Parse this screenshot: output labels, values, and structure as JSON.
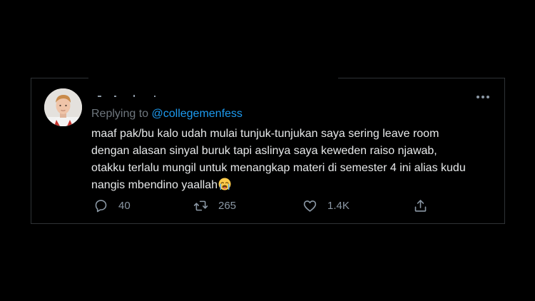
{
  "tweet": {
    "replying_prefix": "Replying to ",
    "replying_handle": "@collegemenfess",
    "text_lines": [
      "maaf pak/bu kalo udah mulai tunjuk-tunjukan saya sering leave room",
      "dengan alasan sinyal buruk tapi aslinya saya keweden raiso njawab,",
      "otakku terlalu mungil untuk menangkap materi di semester 4 ini alias kudu",
      "nangis mbendino yaallah"
    ],
    "emoji": "loudly-crying-face"
  },
  "actions": {
    "reply_count": "40",
    "retweet_count": "265",
    "like_count": "1.4K"
  },
  "icons": {
    "reply": "reply-icon",
    "retweet": "retweet-icon",
    "like": "heart-icon",
    "share": "share-icon",
    "more": "more-icon"
  },
  "colors": {
    "background": "#000000",
    "text": "#e7e9ea",
    "secondary": "#8b98a5",
    "accent": "#1d9bf0",
    "border": "#2f3336"
  }
}
